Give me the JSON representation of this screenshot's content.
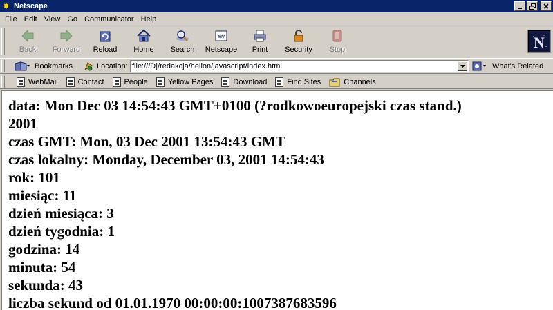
{
  "window": {
    "title": "Netscape"
  },
  "menu": [
    "File",
    "Edit",
    "View",
    "Go",
    "Communicator",
    "Help"
  ],
  "toolbar": {
    "buttons": [
      {
        "label": "Back",
        "icon": "back-arrow-icon",
        "enabled": false
      },
      {
        "label": "Forward",
        "icon": "forward-arrow-icon",
        "enabled": false
      },
      {
        "label": "Reload",
        "icon": "reload-icon",
        "enabled": true
      },
      {
        "label": "Home",
        "icon": "home-icon",
        "enabled": true
      },
      {
        "label": "Search",
        "icon": "search-icon",
        "enabled": true
      },
      {
        "label": "Netscape",
        "icon": "netscape-icon",
        "enabled": true
      },
      {
        "label": "Print",
        "icon": "print-icon",
        "enabled": true
      },
      {
        "label": "Security",
        "icon": "lock-icon",
        "enabled": true
      },
      {
        "label": "Stop",
        "icon": "stop-icon",
        "enabled": false
      }
    ],
    "logo_letter": "N"
  },
  "location_bar": {
    "bookmarks_label": "Bookmarks",
    "location_label": "Location:",
    "url": "file:///D|/redakcja/helion/javascript/index.html",
    "whats_related_label": "What's Related"
  },
  "personal_toolbar": {
    "items": [
      "WebMail",
      "Contact",
      "People",
      "Yellow Pages",
      "Download",
      "Find Sites",
      "Channels"
    ]
  },
  "content": {
    "lines": [
      "data: Mon Dec 03 14:54:43 GMT+0100 (?rodkowoeuropejski czas stand.)",
      "2001",
      "czas GMT: Mon, 03 Dec 2001 13:54:43 GMT",
      "czas lokalny: Monday, December 03, 2001 14:54:43",
      "rok: 101",
      "miesiąc: 11",
      "dzień miesiąca: 3",
      "dzień tygodnia: 1",
      "godzina: 14",
      "minuta: 54",
      "sekunda: 43",
      "liczba sekund od 01.01.1970 00:00:00:1007387683596"
    ]
  },
  "colors": {
    "titlebar": "#0a246a",
    "chrome": "#d4d0c8",
    "content_bg": "#ffffff"
  }
}
